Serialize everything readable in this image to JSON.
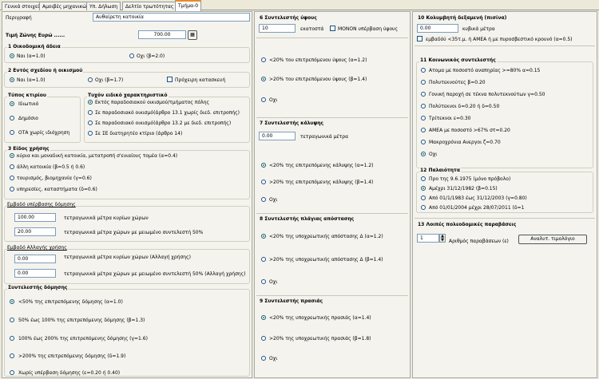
{
  "tabs": [
    "Γενικά στοιχεία",
    "Αμοιβές μηχανικών",
    "Υπ. Δήλωση",
    "Δελτίο τρωτότητας",
    "Τμήμα-0"
  ],
  "left": {
    "perigrafi_label": "Περιγραφή",
    "perigrafi_value": "Αυθαίρετη κατοικία",
    "timi_label": "Τιμή Ζώνης Ευρώ ......",
    "timi_value": "700.00",
    "g1_title": "1 Οικοδομική άδεια",
    "g1_opts": [
      "Ναι (α=1.0)",
      "Οχι (β=2.0)"
    ],
    "g2_title": "2 Εντός σχεδίου ή οικισμού",
    "g2_opts": [
      "Ναι (α=1.0)",
      "Οχι (β=1.7)"
    ],
    "g2_check": "Πρόχειρη κατασκευή",
    "typos_title": "Τύπος κτιρίου",
    "typos_opts": [
      "Ιδιωτικό",
      "Δημόσιο",
      "ΟΤΑ χωρίς ιδιόχρηση"
    ],
    "eidiko_title": "Τυχόν ειδικό χαρακτηριστικό",
    "eidiko_opts": [
      "Εκτός παραδοσιακού οικισμού/τμήματος πόλης",
      "Σε παραδοσιακό οικισμό(άρθρο 13.1 χωρίς διεδ. επιτροπής)",
      "Σε παραδοσιακό οικισμό(άρθρο 13.2 με διεδ. επιτροπής)",
      "Σε ΣΕ διατηρητέο κτίριο (άρθρο 14)"
    ],
    "g3_title": "3 Είδος χρήσης",
    "g3_opts": [
      "κύρια και μοναδική κατοικία, μετατροπή σ'ενιαίους τομέα (α=0.4)",
      "άλλη κατοικία (β=0.5 ή 0.6)",
      "τουρισμός, βιομηχανία (γ=0.6)",
      "υπηρεσίες, καταστήματα (δ=0.6)"
    ],
    "embadon_title": "Εμβαδό υπέρβασης δόμησης",
    "embadon_rows": [
      {
        "value": "100.00",
        "label": "τετραγωνικά μέτρα κυρίων χώρων"
      },
      {
        "value": "20.00",
        "label": "τετραγωνικά μέτρα χώρων με μειωμένο συντελεστή 50%"
      }
    ],
    "allagi_title": "Εμβαδό Αλλαγής χρήσης",
    "allagi_rows": [
      {
        "value": "0.00",
        "label": "τετραγωνικά μέτρα κυρίων χώρων (Αλλαγή χρήσης)"
      },
      {
        "value": "0.00",
        "label": "τετραγωνικά μέτρα χώρων με μειωμένο συντελεστή 50% (Αλλαγή χρήσης)"
      }
    ],
    "syntelestis_title": "Συντελεστής δόμησης",
    "syntelestis_opts": [
      "<50% της επιτρεπόμενης δόμησης (α=1.0)",
      "50% έως 100% της επιτρεπόμενης δόμησης (β=1.3)",
      "100% έως 200% της επιτρεπόμενης δόμησης (γ=1.6)",
      ">200% της επιτρεπόμενης δόμησης (δ=1.9)",
      "Χωρίς υπέρβαση δόμησης (ε=0.20 ή 0.40)"
    ]
  },
  "mid": {
    "g6_title": "6 Συντελεστής ύψους",
    "g6_value": "10",
    "g6_unit": "εκατοστά",
    "g6_check": "ΜΟΝΟΝ υπέρβαση ύψους",
    "g6_opts": [
      "<20% του επιτρεπόμενου ύψους (α=1.2)",
      ">20% του επιτρεπόμενου ύψους (β=1.4)",
      "Οχι"
    ],
    "g7_title": "7 Συντελεστής κάλυψης",
    "g7_value": "0.00",
    "g7_unit": "τετραγωνικά μέτρα",
    "g7_opts": [
      "<20% της επιτρεπόμενης κάλυψης (α=1.2)",
      ">20% της επιτρεπόμενης κάλυψης (β=1.4)",
      "Οχι"
    ],
    "g8_title": "8 Συντελεστής πλάγιας απόστασης",
    "g8_opts": [
      "<20% της υποχρεωτικής απόστασης Δ (α=1.2)",
      ">20% της υποχρεωτικής απόστασης Δ (β=1.4)",
      "Οχι"
    ],
    "g9_title": "9 Συντελεστής πρασιάς",
    "g9_opts": [
      "<20% της υποχρεωτικής πρασιάς (α=1.4)",
      ">20% της υποχρεωτικής πρασιάς (β=1.8)",
      "Οχι"
    ]
  },
  "right": {
    "g10_title": "10 Κολυμβητή δεξαμενή (πισίνα)",
    "g10_value": "0.00",
    "g10_unit": "κυβικά μέτρα",
    "g10_check": "εμβαδόύ <35τ.μ. ή ΑΜΕΑ ή με πυροσβεστικό κρουνό (α=0.5)",
    "g11_title": "11 Κοινωνικός συντελεστής",
    "g11_opts": [
      "Ατομα με ποσοστό αναπηρίας >=80% α=0.15",
      "Πολυτεκνούτες β=0.20",
      "Γονική παροχή σε τέκνα πολυτεκνούτων γ=0.50",
      "Πολύτεκνοι δ=0.20 ή δ=0.50",
      "Τρίτεκνοι ε=0.30",
      "ΑΜΕΑ με ποσοστό >67% στ=0.20",
      "Μακροχρόνια Ανεργοι ζ=0.70",
      "Οχι"
    ],
    "g12_title": "12 Παλαιότητα",
    "g12_opts": [
      "Προ της 9.6.1975 (μόνο πρόβολο)",
      "Αμέχρι 31/12/1982 (β=0.15)",
      "Από 01/1/1983 έως 31/12/2003 (γ=0.80)",
      "Από 01/01/2004 μέχρι 28/07/2011 (δ=1"
    ],
    "g13_title": "13 Λοιπές πολεοδομικές παραβάσεις",
    "g13_value": "1",
    "g13_label": "Αριθμός παραβάσεων (ε)",
    "g13_button": "Αναλυτ. τιμολόγιο"
  },
  "colors": {
    "bg": "#ece9d8",
    "panel": "#f4f3ee",
    "accent": "#e68b2c",
    "radio_dot": "#21a121"
  }
}
